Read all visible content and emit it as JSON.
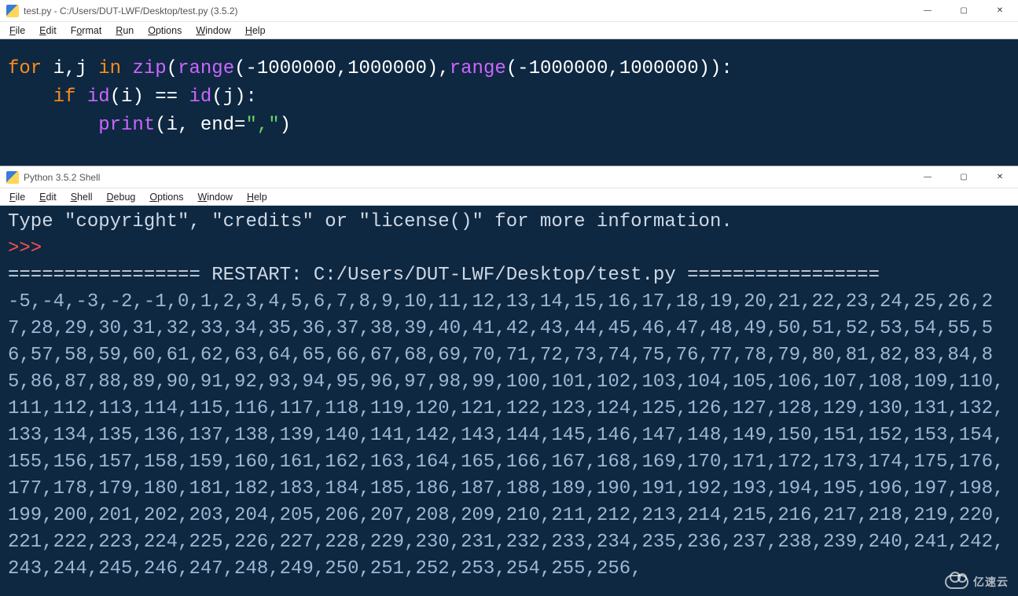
{
  "editor": {
    "title": "test.py - C:/Users/DUT-LWF/Desktop/test.py (3.5.2)",
    "menus": {
      "file": {
        "label": "File",
        "ul": "F"
      },
      "edit": {
        "label": "Edit",
        "ul": "E"
      },
      "format": {
        "label": "Format",
        "ul": "o"
      },
      "run": {
        "label": "Run",
        "ul": "R"
      },
      "options": {
        "label": "Options",
        "ul": "O"
      },
      "window": {
        "label": "Window",
        "ul": "W"
      },
      "help": {
        "label": "Help",
        "ul": "H"
      }
    },
    "code": {
      "l1": {
        "for": "for",
        "ij": " i,j ",
        "in": "in",
        "sp": " ",
        "zip": "zip",
        "op": "(",
        "range1": "range",
        "a1": "(-1000000,1000000),",
        "range2": "range",
        "a2": "(-1000000,1000000)):"
      },
      "l2": {
        "indent": "    ",
        "if": "if",
        "sp": " ",
        "id1": "id",
        "p1": "(i) == ",
        "id2": "id",
        "p2": "(j):"
      },
      "l3": {
        "indent": "        ",
        "print": "print",
        "op": "(i, end=",
        "str": "\",\"",
        "cl": ")"
      }
    }
  },
  "shell": {
    "title": "Python 3.5.2 Shell",
    "menus": {
      "file": {
        "label": "File",
        "ul": "F"
      },
      "edit": {
        "label": "Edit",
        "ul": "E"
      },
      "shell": {
        "label": "Shell",
        "ul": "S"
      },
      "debug": {
        "label": "Debug",
        "ul": "D"
      },
      "options": {
        "label": "Options",
        "ul": "O"
      },
      "window": {
        "label": "Window",
        "ul": "W"
      },
      "help": {
        "label": "Help",
        "ul": "H"
      }
    },
    "info_line": "Type \"copyright\", \"credits\" or \"license()\" for more information.",
    "prompt": ">>> ",
    "restart": "================= RESTART: C:/Users/DUT-LWF/Desktop/test.py =================",
    "output": "-5,-4,-3,-2,-1,0,1,2,3,4,5,6,7,8,9,10,11,12,13,14,15,16,17,18,19,20,21,22,23,24,25,26,27,28,29,30,31,32,33,34,35,36,37,38,39,40,41,42,43,44,45,46,47,48,49,50,51,52,53,54,55,56,57,58,59,60,61,62,63,64,65,66,67,68,69,70,71,72,73,74,75,76,77,78,79,80,81,82,83,84,85,86,87,88,89,90,91,92,93,94,95,96,97,98,99,100,101,102,103,104,105,106,107,108,109,110,111,112,113,114,115,116,117,118,119,120,121,122,123,124,125,126,127,128,129,130,131,132,133,134,135,136,137,138,139,140,141,142,143,144,145,146,147,148,149,150,151,152,153,154,155,156,157,158,159,160,161,162,163,164,165,166,167,168,169,170,171,172,173,174,175,176,177,178,179,180,181,182,183,184,185,186,187,188,189,190,191,192,193,194,195,196,197,198,199,200,201,202,203,204,205,206,207,208,209,210,211,212,213,214,215,216,217,218,219,220,221,222,223,224,225,226,227,228,229,230,231,232,233,234,235,236,237,238,239,240,241,242,243,244,245,246,247,248,249,250,251,252,253,254,255,256,"
  },
  "winbtns": {
    "min": "—",
    "max": "▢",
    "close": "✕"
  },
  "watermark": "亿速云"
}
